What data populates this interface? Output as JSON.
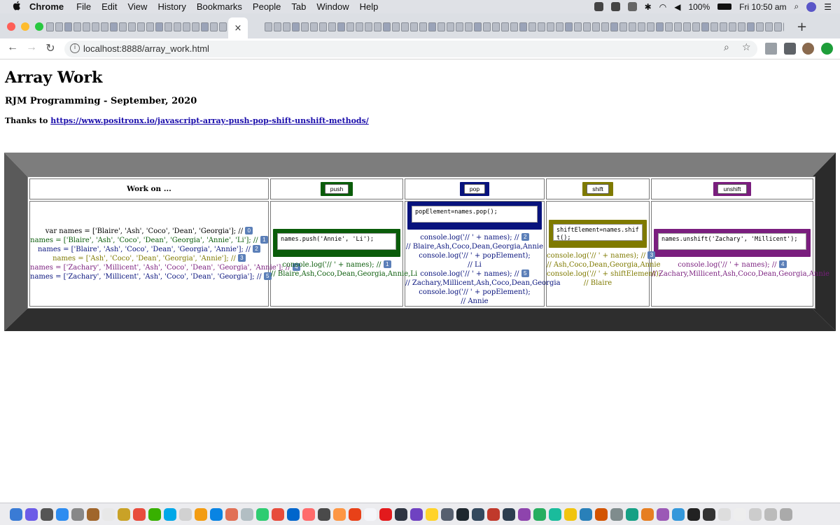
{
  "menubar": {
    "app": "Chrome",
    "items": [
      "File",
      "Edit",
      "View",
      "History",
      "Bookmarks",
      "People",
      "Tab",
      "Window",
      "Help"
    ],
    "battery": "100%",
    "clock": "Fri 10:50 am"
  },
  "tabs": {
    "close_glyph": "×",
    "new_tab_glyph": "+"
  },
  "toolbar": {
    "back": "←",
    "forward": "→",
    "reload": "↻",
    "info": "i",
    "url": "localhost:8888/array_work.html",
    "zoom": "⌕",
    "star": "☆"
  },
  "page": {
    "title": "Array Work",
    "subtitle": "RJM Programming - September, 2020",
    "thanks_prefix": "Thanks to ",
    "thanks_link": "https://www.positronx.io/javascript-array-push-pop-shift-unshift-methods/"
  },
  "table": {
    "work_on_label": "Work on ...",
    "columns": [
      {
        "key": "push",
        "label": "push",
        "color": "#0a5c0a",
        "code": "names.push('Annie', 'Li');",
        "lines": [
          [
            "console.log('// ' + names); // ",
            "1"
          ],
          [
            "// Blaire,Ash,Coco,Dean,Georgia,Annie,Li",
            ""
          ]
        ]
      },
      {
        "key": "pop",
        "label": "pop",
        "color": "#08137d",
        "code": "popElement=names.pop();",
        "lines": [
          [
            "console.log('// ' + names); // ",
            "2"
          ],
          [
            "// Blaire,Ash,Coco,Dean,Georgia,Annie",
            ""
          ],
          [
            "console.log('// ' + popElement);",
            ""
          ],
          [
            "// Li",
            ""
          ],
          [
            "console.log('// ' + names); // ",
            "5"
          ],
          [
            "// Zachary,Millicent,Ash,Coco,Dean,Georgia",
            ""
          ],
          [
            "console.log('// ' + popElement);",
            ""
          ],
          [
            "// Annie",
            ""
          ]
        ]
      },
      {
        "key": "shift",
        "label": "shift",
        "color": "#7f7a00",
        "code": "shiftElement=names.shift();",
        "lines": [
          [
            "console.log('// ' + names); // ",
            "3"
          ],
          [
            "// Ash,Coco,Dean,Georgia,Annie",
            ""
          ],
          [
            "console.log('// ' + shiftElement);",
            ""
          ],
          [
            "// Blaire",
            ""
          ]
        ]
      },
      {
        "key": "unshift",
        "label": "unshift",
        "color": "#7a1e7e",
        "code": "names.unshift('Zachary', 'Millicent');",
        "lines": [
          [
            "console.log('// ' + names); // ",
            "4"
          ],
          [
            "// Zachary,Millicent,Ash,Coco,Dean,Georgia,Annie",
            ""
          ]
        ]
      }
    ],
    "work_lines": [
      {
        "text": "var names = ['Blaire', 'Ash', 'Coco', 'Dean', 'Georgia']; // ",
        "badge": "0",
        "color": "#000000"
      },
      {
        "text": "names = ['Blaire', 'Ash', 'Coco', 'Dean', 'Georgia', 'Annie', 'Li']; // ",
        "badge": "1",
        "color": "#0a5c0a"
      },
      {
        "text": "names = ['Blaire', 'Ash', 'Coco', 'Dean', 'Georgia', 'Annie']; // ",
        "badge": "2",
        "color": "#08137d"
      },
      {
        "text": "names = ['Ash', 'Coco', 'Dean', 'Georgia', 'Annie']; // ",
        "badge": "3",
        "color": "#7f7a00"
      },
      {
        "text": "names = ['Zachary', 'Millicent', 'Ash', 'Coco', 'Dean', 'Georgia', 'Annie']; // ",
        "badge": "4",
        "color": "#7a1e7e"
      },
      {
        "text": "names = ['Zachary', 'Millicent', 'Ash', 'Coco', 'Dean', 'Georgia']; // ",
        "badge": "5",
        "color": "#08137d"
      }
    ]
  }
}
